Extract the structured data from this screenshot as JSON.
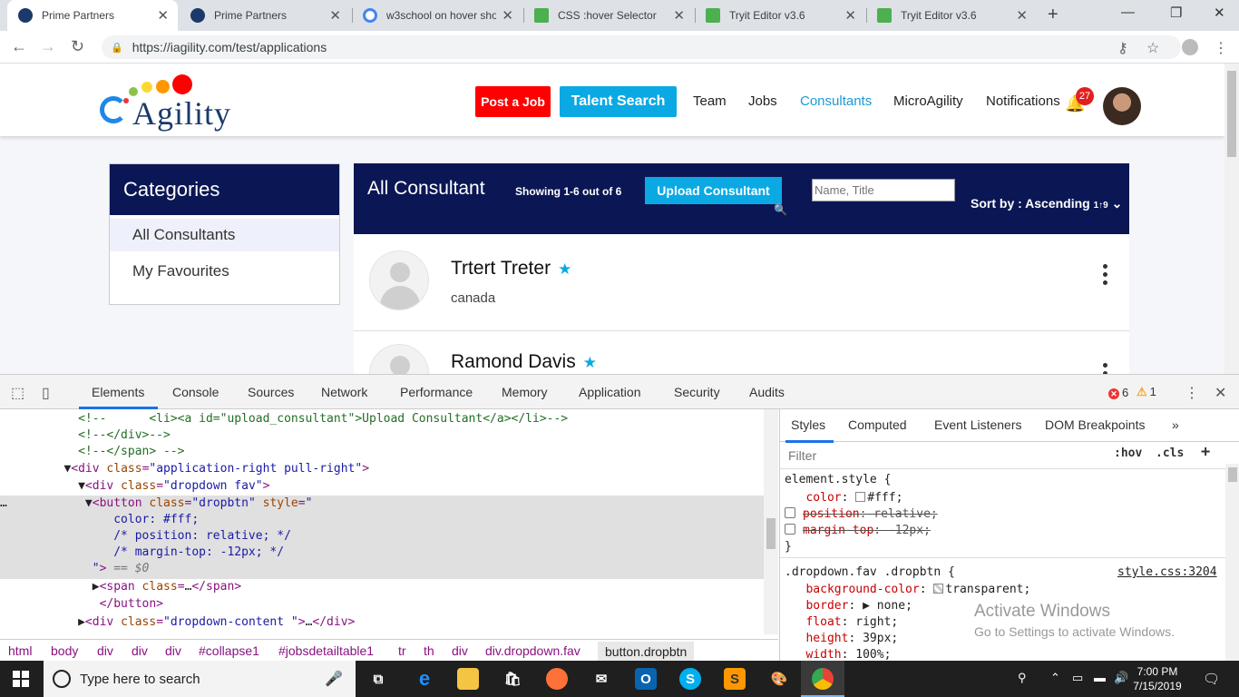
{
  "browser": {
    "tabs": [
      {
        "title": "Prime Partners",
        "active": true,
        "icon": "prime-partners-favicon"
      },
      {
        "title": "Prime Partners",
        "active": false,
        "icon": "prime-partners-favicon"
      },
      {
        "title": "w3school on hover sho",
        "active": false,
        "icon": "google-favicon"
      },
      {
        "title": "CSS :hover Selector",
        "active": false,
        "icon": "w3schools-favicon"
      },
      {
        "title": "Tryit Editor v3.6",
        "active": false,
        "icon": "w3schools-favicon"
      },
      {
        "title": "Tryit Editor v3.6",
        "active": false,
        "icon": "w3schools-favicon"
      }
    ],
    "url": "https://iagility.com/test/applications"
  },
  "site": {
    "logo_text": "Agility",
    "post_job": "Post a Job",
    "talent_search": "Talent Search",
    "nav": [
      "Team",
      "Jobs",
      "Consultants",
      "MicroAgility",
      "Notifications"
    ],
    "active_nav": "Consultants",
    "notification_count": "27",
    "colors": {
      "navy": "#0b1754",
      "accent": "#0aa9e4",
      "red": "#ff0000"
    }
  },
  "categories": {
    "title": "Categories",
    "items": [
      "All Consultants",
      "My Favourites"
    ],
    "selected": "All Consultants"
  },
  "consultants": {
    "title": "All Consultant",
    "showing": "Showing 1-6 out of 6",
    "upload_label": "Upload Consultant",
    "search_placeholder": "Name, Title",
    "sort_label": "Sort by : Ascending",
    "sort_icon": "1↑9",
    "rows": [
      {
        "name": "Trtert Treter",
        "location": "canada"
      },
      {
        "name": "Ramond Davis",
        "location": ""
      }
    ]
  },
  "devtools": {
    "tabs": [
      "Elements",
      "Console",
      "Sources",
      "Network",
      "Performance",
      "Memory",
      "Application",
      "Security",
      "Audits"
    ],
    "active_tab": "Elements",
    "errors": "6",
    "warnings": "1",
    "breadcrumbs": [
      "html",
      "body",
      "div",
      "div",
      "div",
      "#collapse1",
      "#jobsdetailtable1",
      "tr",
      "th",
      "div",
      "div.dropdown.fav",
      "button.dropbtn"
    ],
    "styles_tabs": [
      "Styles",
      "Computed",
      "Event Listeners",
      "DOM Breakpoints"
    ],
    "filter_placeholder": "Filter",
    "hov": ":hov",
    "cls": ".cls",
    "plus": "+",
    "element_style": "element.style {",
    "rule_selector": ".dropdown.fav .dropbtn {",
    "rule_source": "style.css:3204",
    "closing_brace": "}",
    "activate_title": "Activate Windows",
    "activate_sub": "Go to Settings to activate Windows."
  },
  "taskbar": {
    "search_placeholder": "Type here to search",
    "time": "7:00 PM",
    "date": "7/15/2019"
  }
}
